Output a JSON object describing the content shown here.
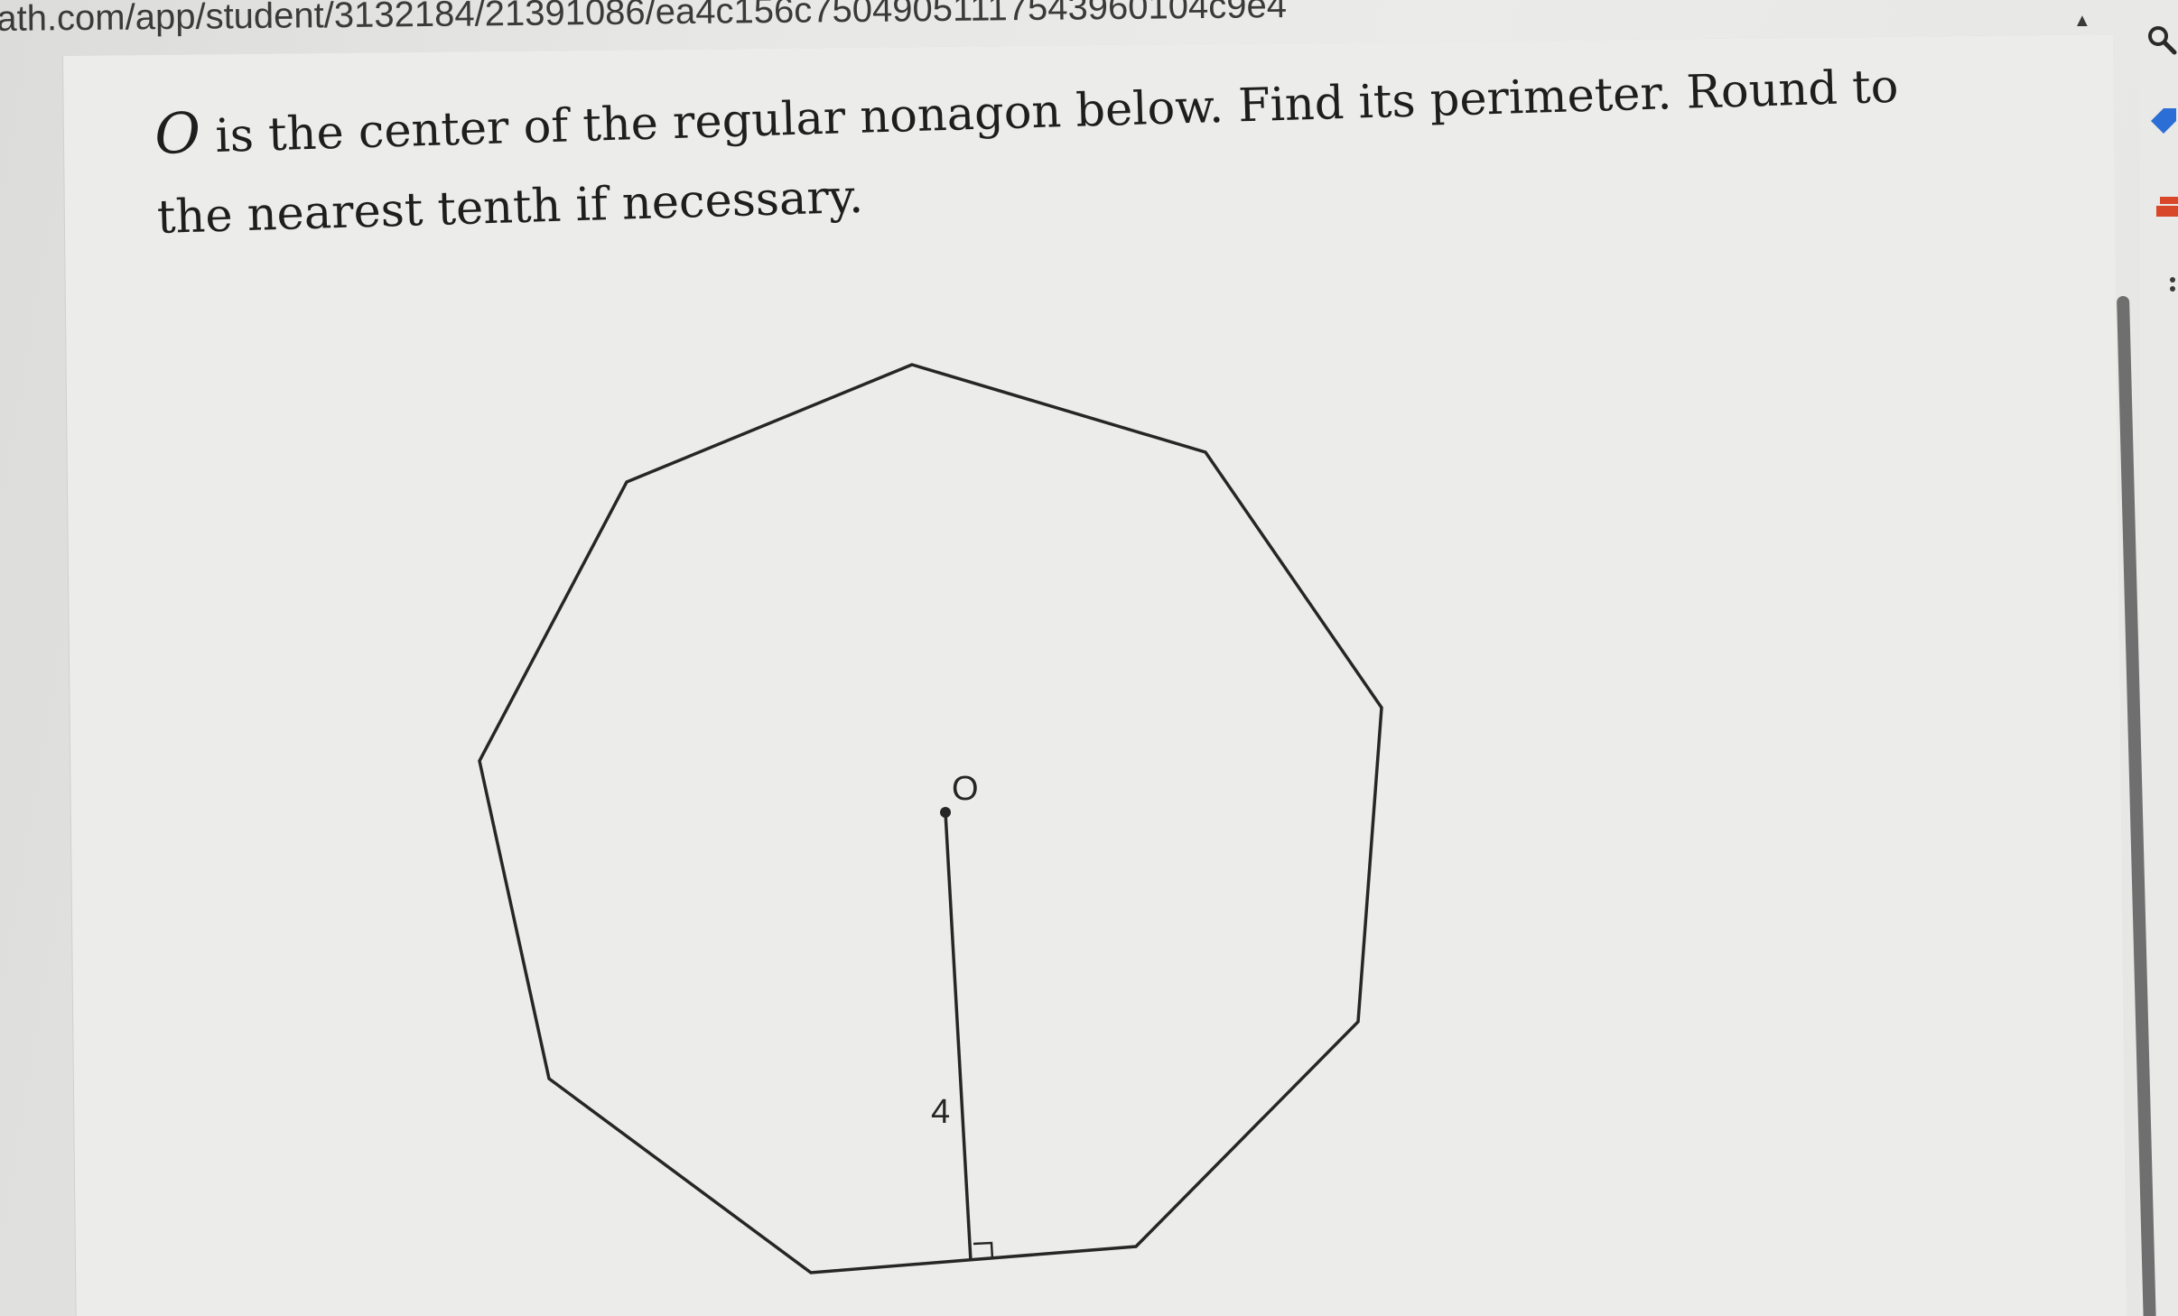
{
  "browser": {
    "url": "ath.com/app/student/3132184/21391086/ea4c156c75049051117543960104c9e4"
  },
  "question": {
    "variable": "O",
    "text": " is the center of the regular nonagon below. Find its perimeter. Round to the nearest tenth if necessary."
  },
  "figure": {
    "center_label": "O",
    "apothem_label": "4"
  },
  "toolbar": {
    "icons": [
      "search-icon",
      "bookmark-icon",
      "extension-icon"
    ]
  }
}
